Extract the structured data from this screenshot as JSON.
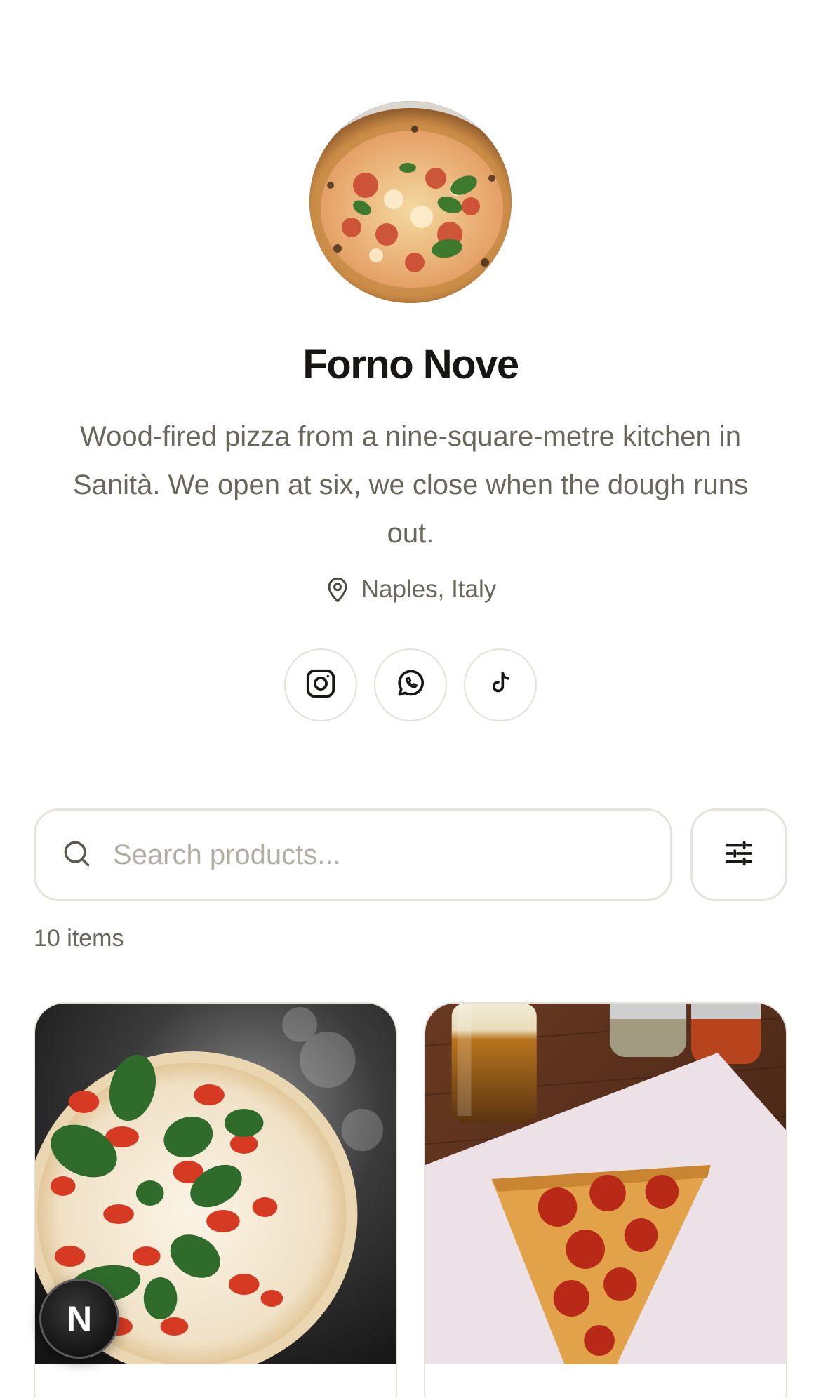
{
  "profile": {
    "avatar_alt": "Forno Nove pizza avatar",
    "name": "Forno Nove",
    "bio_lines": [
      "Wood-fired pizza from a nine-square-metre kitchen in",
      "Sanità. We open at six, we close when the dough runs",
      "out."
    ],
    "location": "Naples, Italy",
    "location_icon": "map-pin-icon"
  },
  "socials": [
    {
      "name": "Instagram",
      "icon": "instagram-icon"
    },
    {
      "name": "WhatsApp",
      "icon": "whatsapp-icon"
    },
    {
      "name": "TikTok",
      "icon": "tiktok-icon"
    }
  ],
  "search": {
    "placeholder": "Search products...",
    "value": "",
    "icon": "search-icon"
  },
  "filter": {
    "icon": "sliders-icon"
  },
  "catalog": {
    "count_label": "10 items",
    "products": [
      {
        "image": "margherita-pizza-photo"
      },
      {
        "image": "pepperoni-slice-photo"
      }
    ]
  },
  "badge": {
    "letter": "N"
  },
  "colors": {
    "text_primary": "#171614",
    "text_muted": "#6b665c",
    "border": "#e7e3da",
    "placeholder": "#b3aea4"
  }
}
